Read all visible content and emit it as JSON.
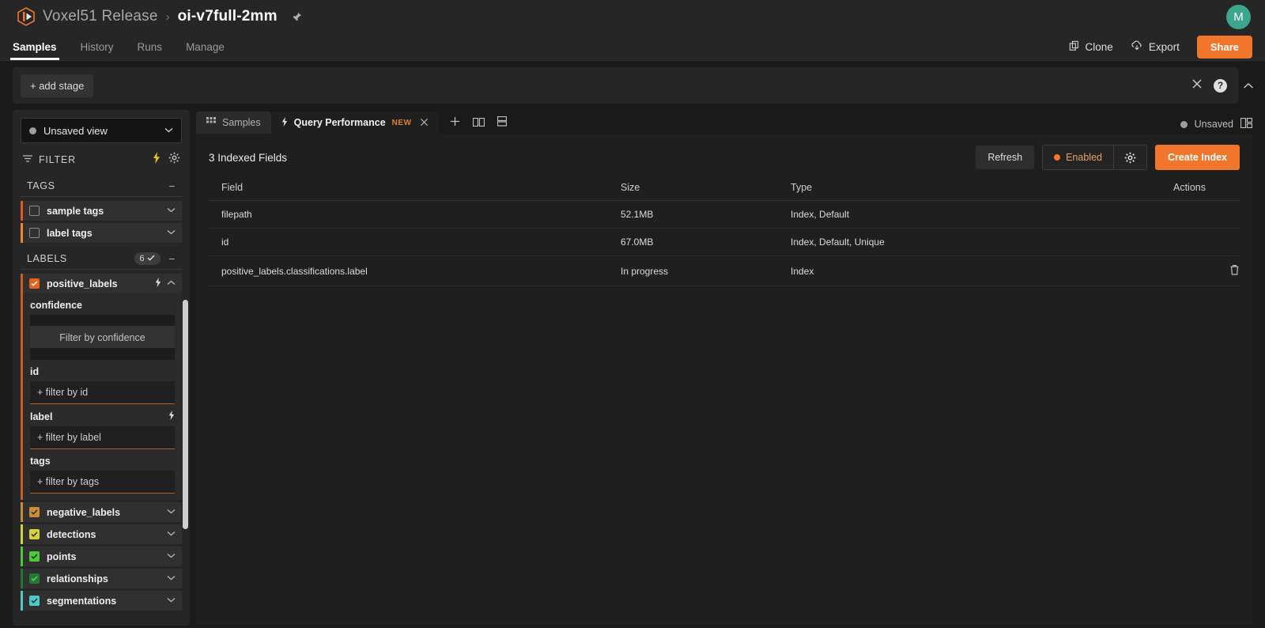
{
  "header": {
    "org": "Voxel51 Release",
    "separator": "›",
    "dataset": "oi-v7full-2mm",
    "avatar_initial": "M",
    "pin_icon": "pin-icon",
    "logo_icon": "voxel51-logo-icon"
  },
  "nav": {
    "tabs": [
      {
        "label": "Samples",
        "active": true
      },
      {
        "label": "History",
        "active": false
      },
      {
        "label": "Runs",
        "active": false
      },
      {
        "label": "Manage",
        "active": false
      }
    ],
    "clone_label": "Clone",
    "clone_icon": "copy-icon",
    "export_label": "Export",
    "export_icon": "cloud-download-icon",
    "share_label": "Share"
  },
  "stage_bar": {
    "add_stage_label": "+ add stage",
    "close_icon": "close-icon",
    "help_label": "?",
    "help_icon": "help-icon",
    "collapse_icon": "chevron-up-icon"
  },
  "sidebar": {
    "view_selector": {
      "label": "Unsaved view",
      "caret_icon": "chevron-down-icon",
      "dot_icon": "status-dot-icon"
    },
    "filter": {
      "label": "FILTER",
      "filter_icon": "filter-icon",
      "bolt_icon": "lightning-icon",
      "settings_icon": "gear-icon"
    },
    "sections": [
      {
        "title": "TAGS",
        "badge": null,
        "collapse_icon": "minus-icon"
      },
      {
        "title": "LABELS",
        "badge": "6",
        "badge_check_icon": "check-icon",
        "collapse_icon": "minus-icon"
      }
    ],
    "tag_fields": [
      {
        "label": "sample tags",
        "checked": false,
        "color": "#f04e23",
        "chevron": "chevron-down-icon"
      },
      {
        "label": "label tags",
        "checked": false,
        "color": "#f0881f",
        "chevron": "chevron-down-icon"
      }
    ],
    "expanded_field": {
      "label": "positive_labels",
      "checked": true,
      "color": "#e8611c",
      "bolt_icon": "lightning-icon",
      "chevron": "chevron-up-icon",
      "subfields": [
        {
          "name": "confidence",
          "type": "slider",
          "placeholder": "Filter by confidence"
        },
        {
          "name": "id",
          "type": "input",
          "placeholder": "+ filter by id"
        },
        {
          "name": "label",
          "type": "input",
          "placeholder": "+ filter by label",
          "bolt": true
        },
        {
          "name": "tags",
          "type": "input",
          "placeholder": "+ filter by tags"
        }
      ]
    },
    "label_fields": [
      {
        "label": "negative_labels",
        "checked": true,
        "color": "#c98e35",
        "chevron": "chevron-down-icon"
      },
      {
        "label": "detections",
        "checked": true,
        "color": "#d4d43a",
        "chevron": "chevron-down-icon"
      },
      {
        "label": "points",
        "checked": true,
        "color": "#4cc93a",
        "chevron": "chevron-down-icon"
      },
      {
        "label": "relationships",
        "checked": true,
        "color": "#1f7a2e",
        "chevron": "chevron-down-icon"
      },
      {
        "label": "segmentations",
        "checked": true,
        "color": "#4cc9c9",
        "chevron": "chevron-down-icon"
      }
    ]
  },
  "workspace": {
    "tabs": [
      {
        "label": "Samples",
        "icon": "grid-icon",
        "active": false,
        "badge": null,
        "closable": false
      },
      {
        "label": "Query Performance",
        "icon": "lightning-icon",
        "active": true,
        "badge": "NEW",
        "closable": true
      }
    ],
    "tools": [
      {
        "icon": "plus-icon",
        "name": "add-panel-button"
      },
      {
        "icon": "split-horizontal-icon",
        "name": "split-horizontal-button"
      },
      {
        "icon": "split-vertical-icon",
        "name": "split-vertical-button"
      }
    ],
    "status": {
      "label": "Unsaved",
      "dot_icon": "status-dot-icon",
      "layout_icon": "layout-icon"
    }
  },
  "panel": {
    "title": "3 Indexed Fields",
    "refresh_label": "Refresh",
    "enabled_label": "Enabled",
    "settings_icon": "gear-icon",
    "create_index_label": "Create Index",
    "table": {
      "columns": [
        "Field",
        "Size",
        "Type",
        "Actions"
      ],
      "rows": [
        {
          "field": "filepath",
          "size": "52.1MB",
          "type": "Index, Default",
          "action_icon": null
        },
        {
          "field": "id",
          "size": "67.0MB",
          "type": "Index, Default, Unique",
          "action_icon": null
        },
        {
          "field": "positive_labels.classifications.label",
          "size": "In progress",
          "type": "Index",
          "action_icon": "trash-icon"
        }
      ]
    }
  },
  "colors": {
    "accent": "#f0762b",
    "panel_bg": "#1f1f1f",
    "sidebar_bg": "#262626",
    "header_bg": "#262626",
    "avatar_bg": "#3ba58d"
  }
}
